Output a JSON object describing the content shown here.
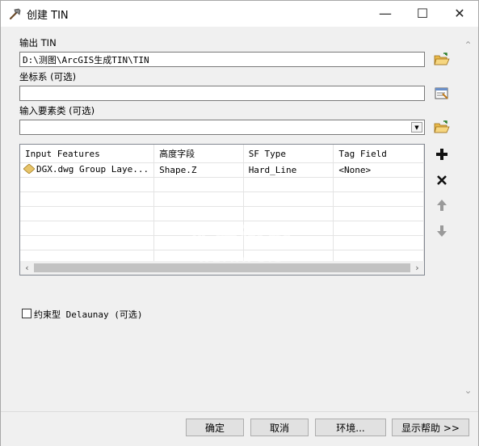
{
  "window": {
    "title": "创建 TIN",
    "minimize": "—",
    "maximize": "☐",
    "close": "✕"
  },
  "output_tin": {
    "label": "输出 TIN",
    "value": "D:\\测图\\ArcGIS生成TIN\\TIN"
  },
  "coordinate_system": {
    "label": "坐标系 (可选)",
    "value": ""
  },
  "input_feature_class": {
    "label": "输入要素类 (可选)",
    "value": ""
  },
  "feature_table": {
    "columns": [
      "Input Features",
      "高度字段",
      "SF Type",
      "Tag Field"
    ],
    "rows": [
      [
        "DGX.dwg Group Laye...",
        "Shape.Z",
        "Hard_Line",
        "<None>"
      ]
    ]
  },
  "constrained_delaunay": {
    "label": "约束型 Delaunay (可选)",
    "checked": false
  },
  "buttons": {
    "ok": "确定",
    "cancel": "取消",
    "environments": "环境...",
    "show_help": "显示帮助 >>"
  },
  "watermark": {
    "line1": "水经微图",
    "line2": "WEMAPSIS"
  },
  "colors": {
    "folder_yellow": "#e8b84a",
    "accent": "#2b2b2b",
    "layer_diamond": "#e7c46a"
  }
}
